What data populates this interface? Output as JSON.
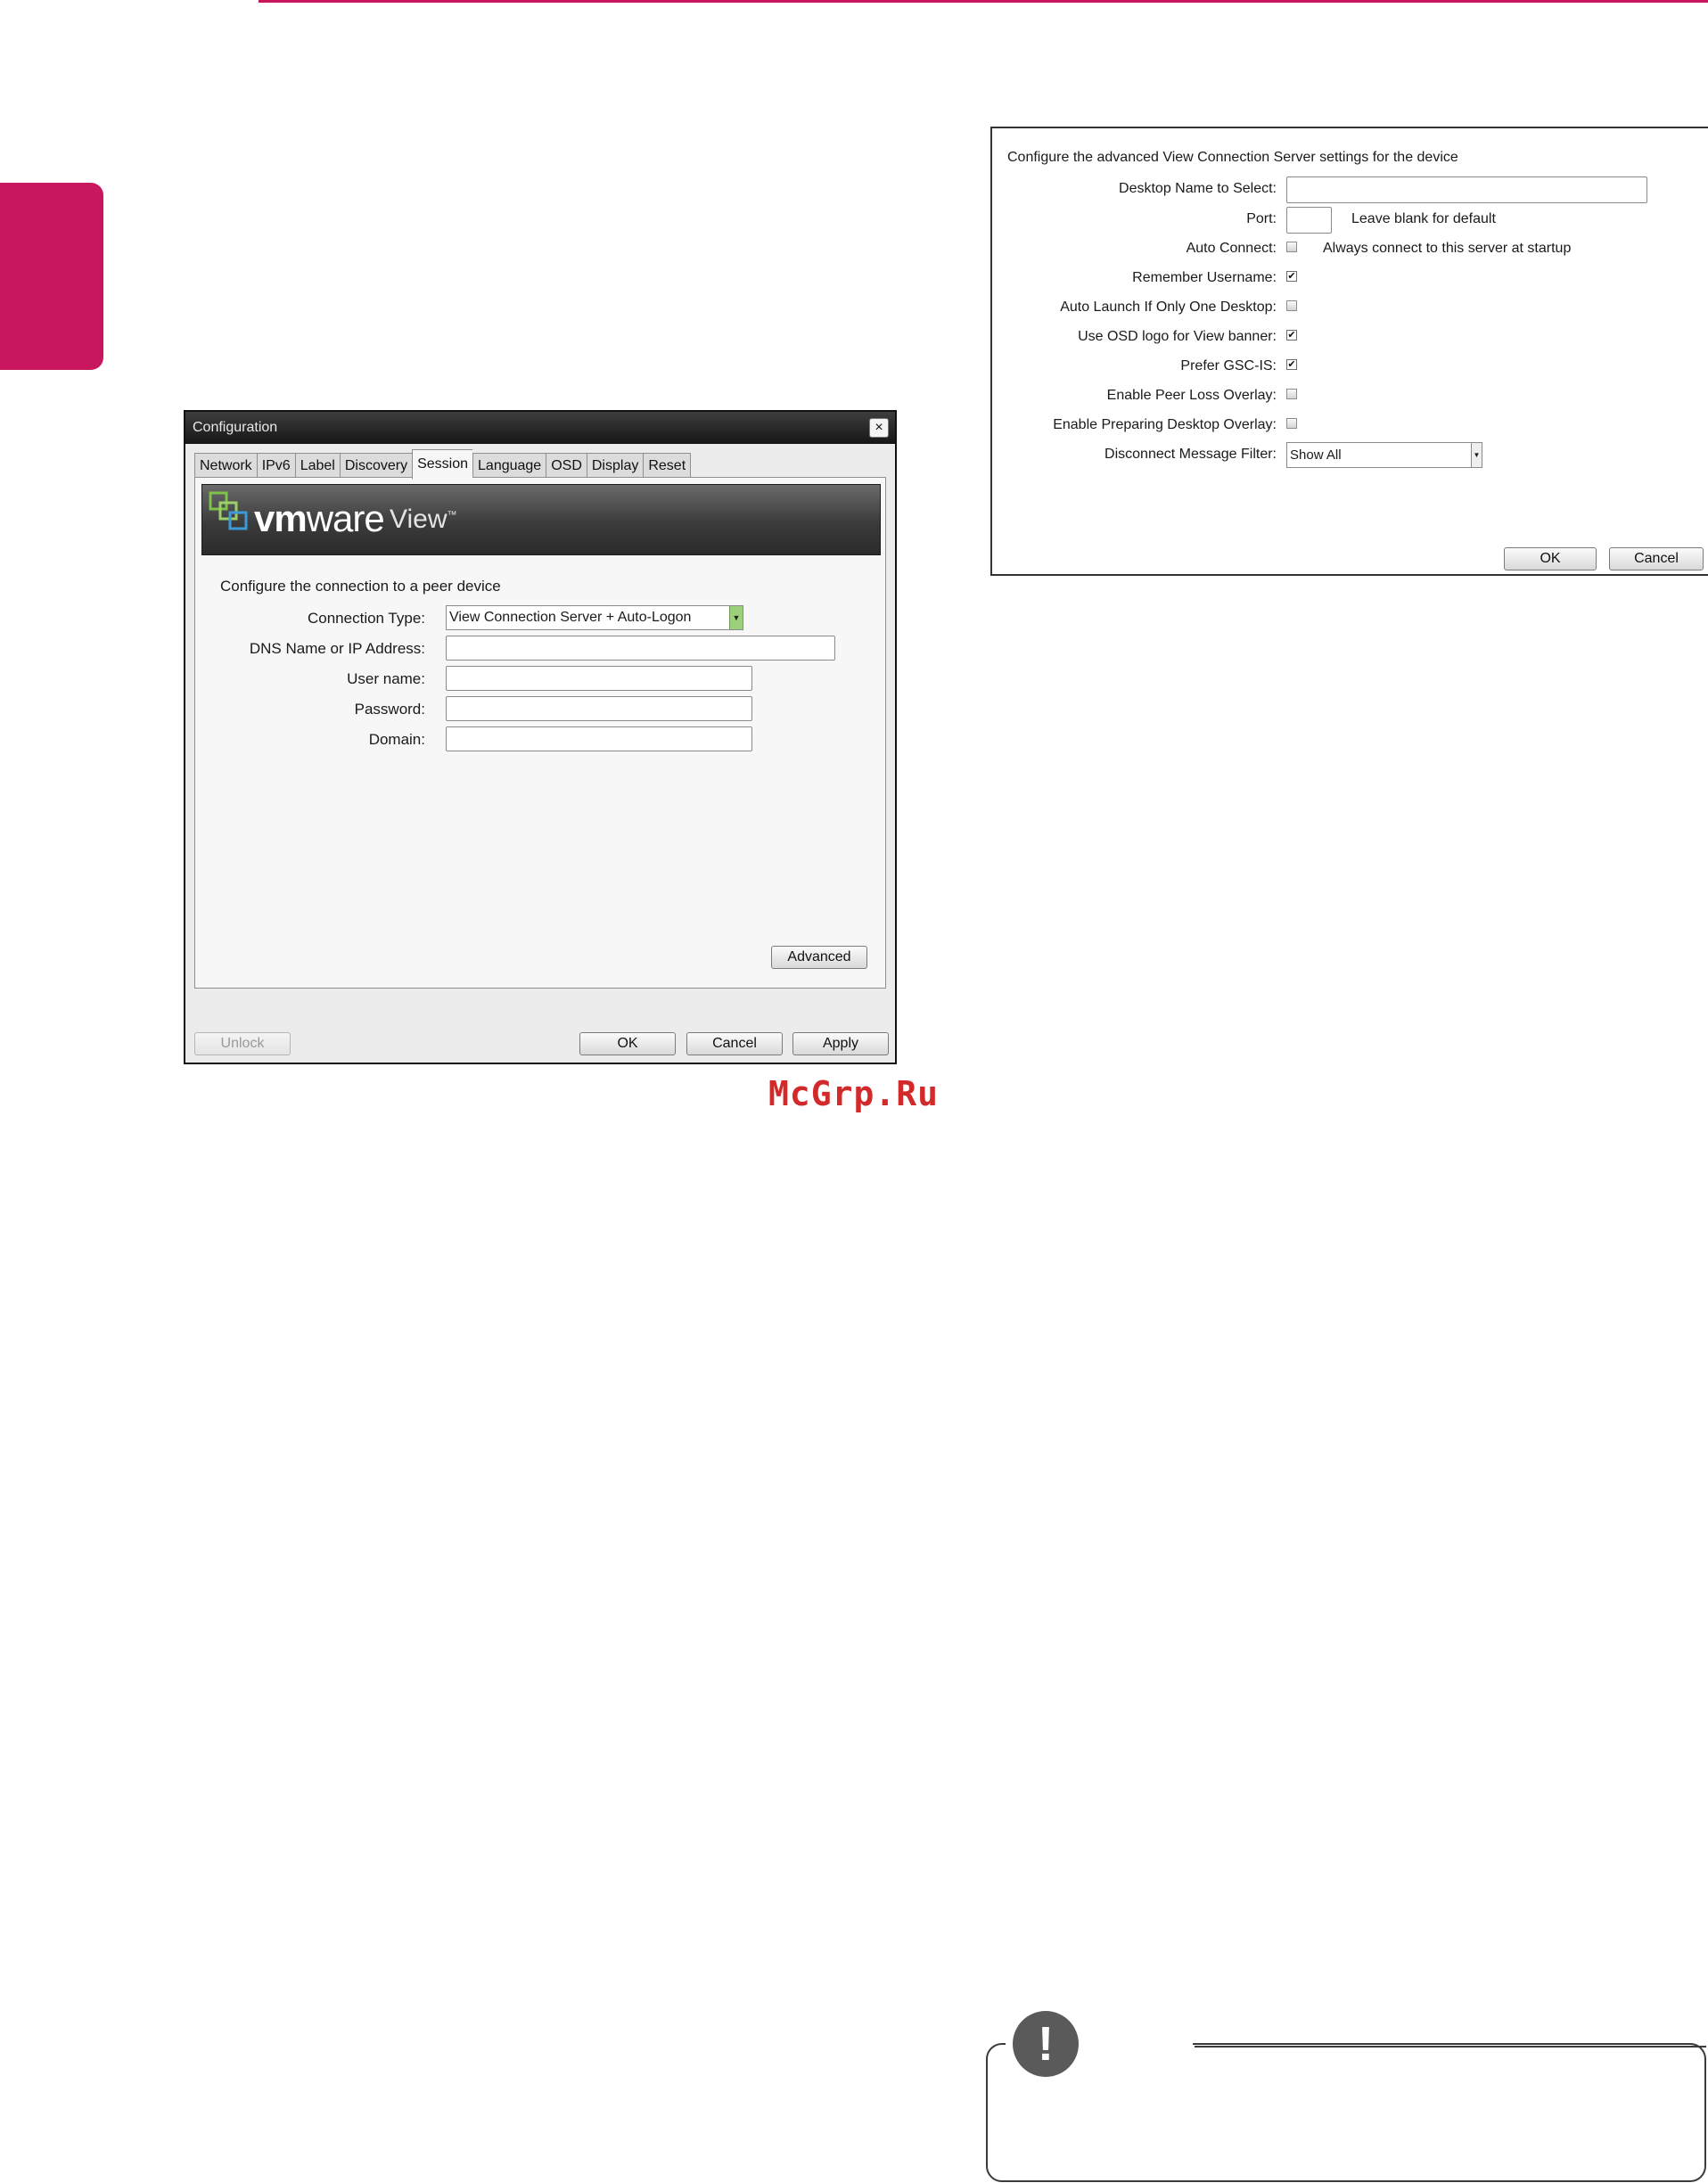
{
  "config_dialog": {
    "title": "Configuration",
    "close_glyph": "×",
    "tabs": [
      "Network",
      "IPv6",
      "Label",
      "Discovery",
      "Session",
      "Language",
      "OSD",
      "Display",
      "Reset"
    ],
    "active_tab": "Session",
    "banner": {
      "brand_vm": "vm",
      "brand_ware": "ware",
      "product": "View",
      "tm": "™",
      "logo_icon": "vmware-squares-icon"
    },
    "intro": "Configure the connection to a peer device",
    "fields": {
      "connection_type_label": "Connection Type:",
      "connection_type_value": "View Connection Server + Auto-Logon",
      "dns_label": "DNS Name or IP Address:",
      "dns_value": "",
      "username_label": "User name:",
      "username_value": "",
      "password_label": "Password:",
      "password_value": "",
      "domain_label": "Domain:",
      "domain_value": ""
    },
    "buttons": {
      "advanced": "Advanced",
      "unlock": "Unlock",
      "ok": "OK",
      "cancel": "Cancel",
      "apply": "Apply"
    }
  },
  "advanced_dialog": {
    "intro": "Configure the advanced View Connection Server settings for the device",
    "desktop_name_label": "Desktop Name to Select:",
    "desktop_name_value": "",
    "port_label": "Port:",
    "port_value": "",
    "port_hint": "Leave blank for default",
    "auto_connect_label": "Auto Connect:",
    "auto_connect_checked": false,
    "auto_connect_hint": "Always connect to this server at startup",
    "remember_username_label": "Remember Username:",
    "remember_username_checked": true,
    "auto_launch_label": "Auto Launch If Only One Desktop:",
    "auto_launch_checked": false,
    "osd_logo_label": "Use OSD logo for View banner:",
    "osd_logo_checked": true,
    "prefer_gsc_label": "Prefer GSC-IS:",
    "prefer_gsc_checked": true,
    "peer_loss_label": "Enable Peer Loss Overlay:",
    "peer_loss_checked": false,
    "preparing_label": "Enable Preparing Desktop Overlay:",
    "preparing_checked": false,
    "disconnect_filter_label": "Disconnect Message Filter:",
    "disconnect_filter_value": "Show All",
    "buttons": {
      "ok": "OK",
      "cancel": "Cancel"
    }
  },
  "watermark": "McGrp.Ru",
  "note_icon_glyph": "!",
  "colors": {
    "accent": "#c8175f",
    "watermark": "#d22a2a"
  }
}
